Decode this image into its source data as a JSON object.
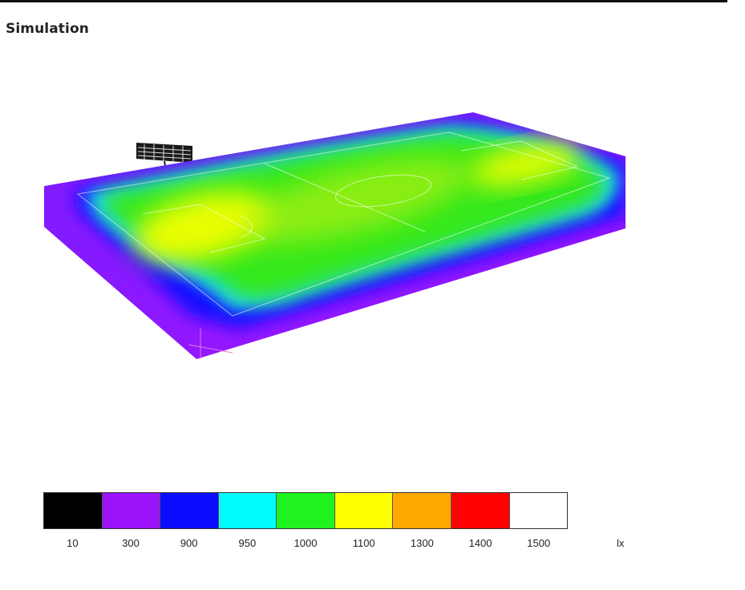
{
  "header": {
    "title": "Simulation"
  },
  "legend": {
    "unit": "lx",
    "entries": [
      {
        "label": "10",
        "color": "#000000"
      },
      {
        "label": "300",
        "color": "#9b13fb"
      },
      {
        "label": "900",
        "color": "#0a0bff"
      },
      {
        "label": "950",
        "color": "#00fcfd"
      },
      {
        "label": "1000",
        "color": "#1ff21f"
      },
      {
        "label": "1100",
        "color": "#ffff00"
      },
      {
        "label": "1300",
        "color": "#ffa800"
      },
      {
        "label": "1400",
        "color": "#ff0000"
      },
      {
        "label": "1500",
        "color": "#ffffff"
      }
    ]
  },
  "heatmap": {
    "background_color": "#8a1cff",
    "edge_color": "#1510ff",
    "transition_color": "#1fd9f2",
    "field_color": "#34e81a",
    "hotspot_color": "#f4ff00"
  }
}
